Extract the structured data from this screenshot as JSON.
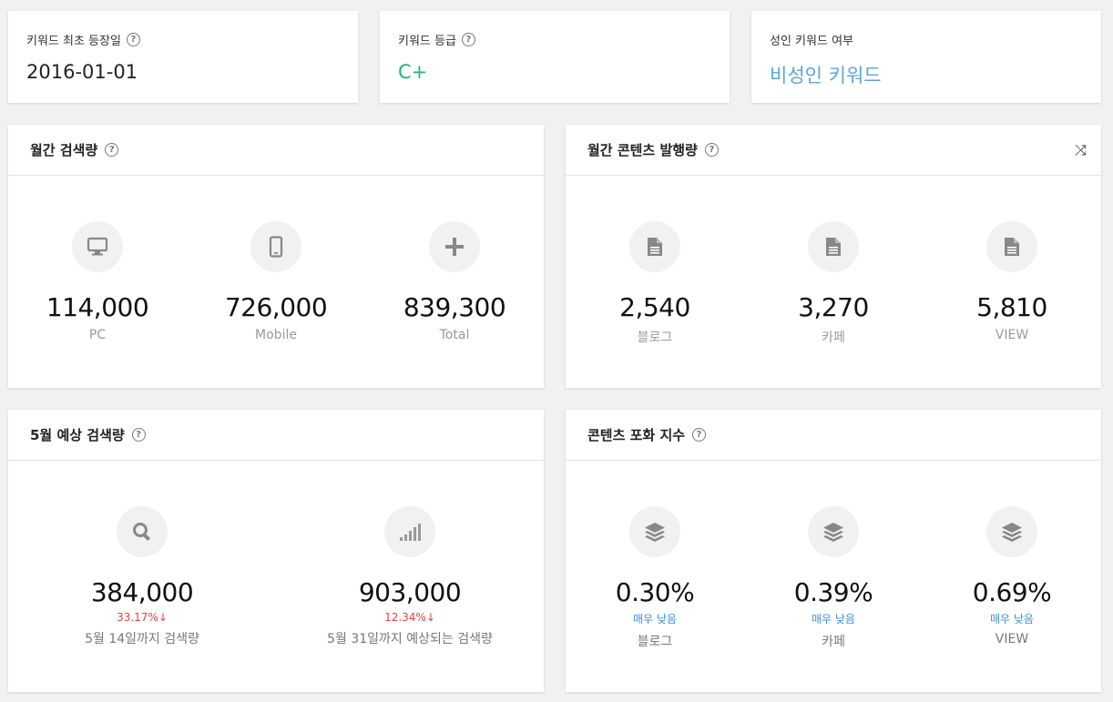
{
  "top": {
    "first_appear": {
      "label": "키워드 최초 등장일",
      "value": "2016-01-01"
    },
    "grade": {
      "label": "키워드 등급",
      "value": "C+",
      "color": "#1cb86c"
    },
    "adult": {
      "label": "성인 키워드 여부",
      "value": "비성인 키워드",
      "color": "#5aa5de"
    }
  },
  "monthly_search": {
    "title": "월간 검색량",
    "items": [
      {
        "icon": "monitor-icon",
        "value": "114,000",
        "label": "PC"
      },
      {
        "icon": "mobile-icon",
        "value": "726,000",
        "label": "Mobile"
      },
      {
        "icon": "plus-icon",
        "value": "839,300",
        "label": "Total"
      }
    ]
  },
  "monthly_content": {
    "title": "월간 콘텐츠 발행량",
    "items": [
      {
        "icon": "document-icon",
        "value": "2,540",
        "label": "블로그"
      },
      {
        "icon": "document-icon",
        "value": "3,270",
        "label": "카페"
      },
      {
        "icon": "document-icon",
        "value": "5,810",
        "label": "VIEW"
      }
    ]
  },
  "may_forecast": {
    "title": "5월 예상 검색량",
    "items": [
      {
        "icon": "search-icon",
        "value": "384,000",
        "change": "33.17%",
        "label": "5월 14일까지 검색량"
      },
      {
        "icon": "signal-bars-icon",
        "value": "903,000",
        "change": "12.34%",
        "label": "5월 31일까지 예상되는 검색량"
      }
    ]
  },
  "saturation": {
    "title": "콘텐츠 포화 지수",
    "items": [
      {
        "icon": "layers-icon",
        "value": "0.30%",
        "level": "매우 낮음",
        "label": "블로그"
      },
      {
        "icon": "layers-icon",
        "value": "0.39%",
        "level": "매우 낮음",
        "label": "카페"
      },
      {
        "icon": "layers-icon",
        "value": "0.69%",
        "level": "매우 낮음",
        "label": "VIEW"
      }
    ]
  },
  "help_glyph": "?",
  "down_arrow": "↓",
  "shuffle_glyph": "⤨"
}
